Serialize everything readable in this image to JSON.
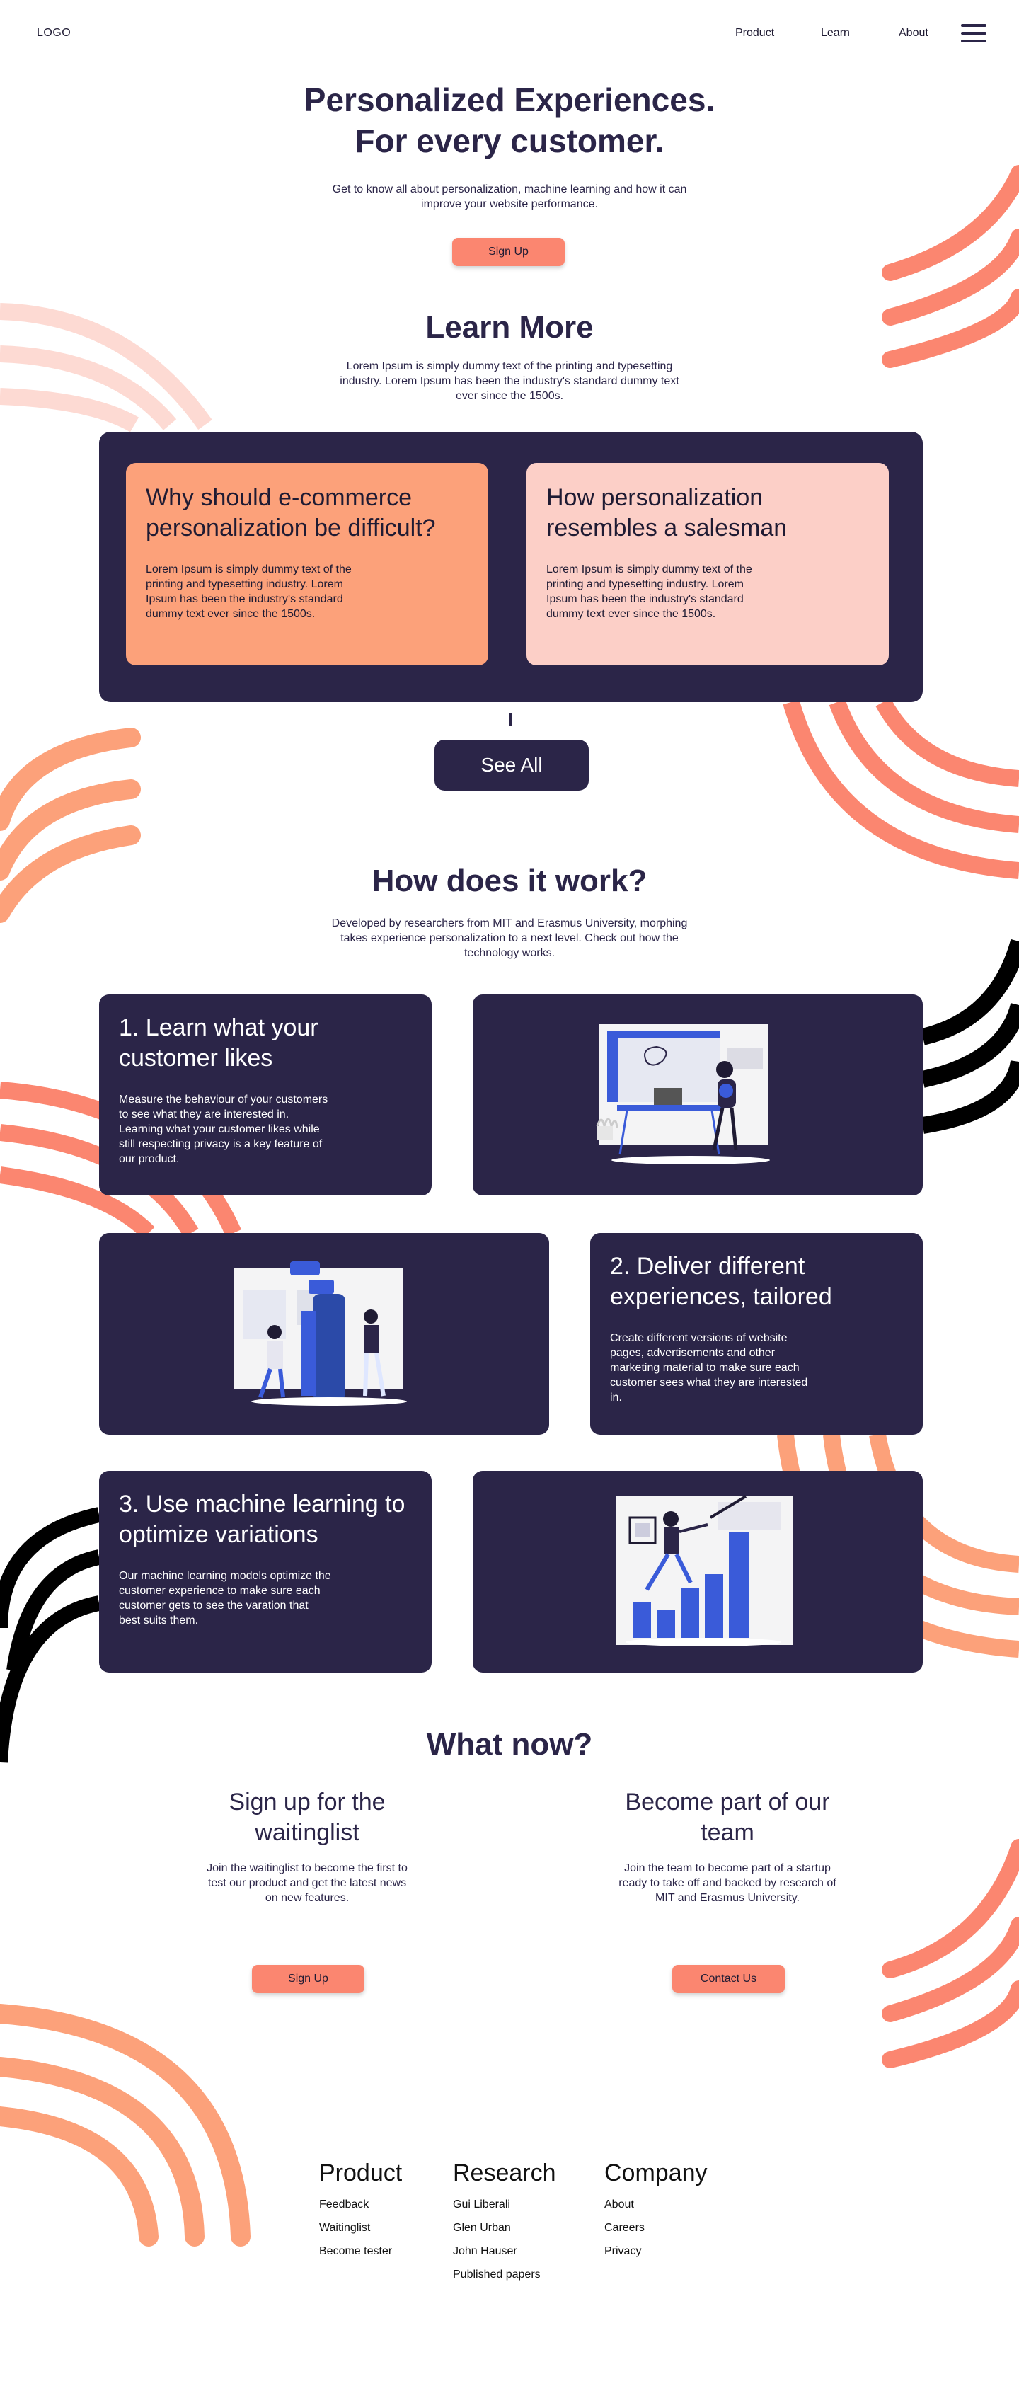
{
  "header": {
    "logo": "LOGO",
    "nav": [
      "Product",
      "Learn",
      "About"
    ]
  },
  "hero": {
    "title_line1": "Personalized Experiences.",
    "title_line2": "For every customer.",
    "subtitle": "Get to know all about personalization, machine learning and how it can improve your website performance.",
    "cta": "Sign Up"
  },
  "learn": {
    "title": "Learn More",
    "subtitle": "Lorem Ipsum is simply dummy text of the printing and typesetting industry. Lorem Ipsum has been the industry's standard dummy text ever since the 1500s.",
    "articles": [
      {
        "title": "Why should e-commerce personalization be difficult?",
        "body": "Lorem Ipsum is simply dummy text of the printing and typesetting industry. Lorem Ipsum has been the industry's standard dummy text ever since the 1500s."
      },
      {
        "title": "How personalization resembles a salesman",
        "body": "Lorem Ipsum is simply dummy text of the printing and typesetting industry. Lorem Ipsum has been the industry's standard dummy text ever since the 1500s."
      }
    ],
    "see_all": "See All"
  },
  "how": {
    "title": "How does it work?",
    "subtitle": "Developed by researchers from MIT and Erasmus University, morphing takes experience personalization to a next level. Check out how the technology works.",
    "steps": [
      {
        "title": "1. Learn what your customer likes",
        "body": "Measure the behaviour of your customers to see what they are interested in.  Learning what your customer likes while still respecting privacy is a key feature of our product."
      },
      {
        "title": "2. Deliver different experiences, tailored",
        "body": "Create different versions of website pages, advertisements and other marketing material to make sure each customer sees what they are interested in."
      },
      {
        "title": "3. Use machine learning to optimize variations",
        "body": "Our machine learning models optimize the customer experience to make sure each customer gets to see the varation that best suits them."
      }
    ]
  },
  "now": {
    "title": "What now?",
    "columns": [
      {
        "title": "Sign up for the waitinglist",
        "body": "Join the waitinglist to become the first to test our product and get the latest news on new features.",
        "button": "Sign Up"
      },
      {
        "title": "Become part of our team",
        "body": "Join the team to become part of a startup ready to take off and backed by research of MIT and Erasmus University.",
        "button": "Contact Us"
      }
    ]
  },
  "footer": {
    "columns": [
      {
        "title": "Product",
        "links": [
          "Feedback",
          "Waitinglist",
          "Become tester"
        ]
      },
      {
        "title": "Research",
        "links": [
          "Gui Liberali",
          "Glen Urban",
          "John Hauser",
          "Published papers"
        ]
      },
      {
        "title": "Company",
        "links": [
          "About",
          "Careers",
          "Privacy"
        ]
      }
    ]
  },
  "colors": {
    "navy": "#2b2548",
    "coral": "#fb8670",
    "orange": "#fca17a",
    "pink": "#fccfc7",
    "light_pink": "#fddad3",
    "accent_blue": "#3a5bd9"
  }
}
